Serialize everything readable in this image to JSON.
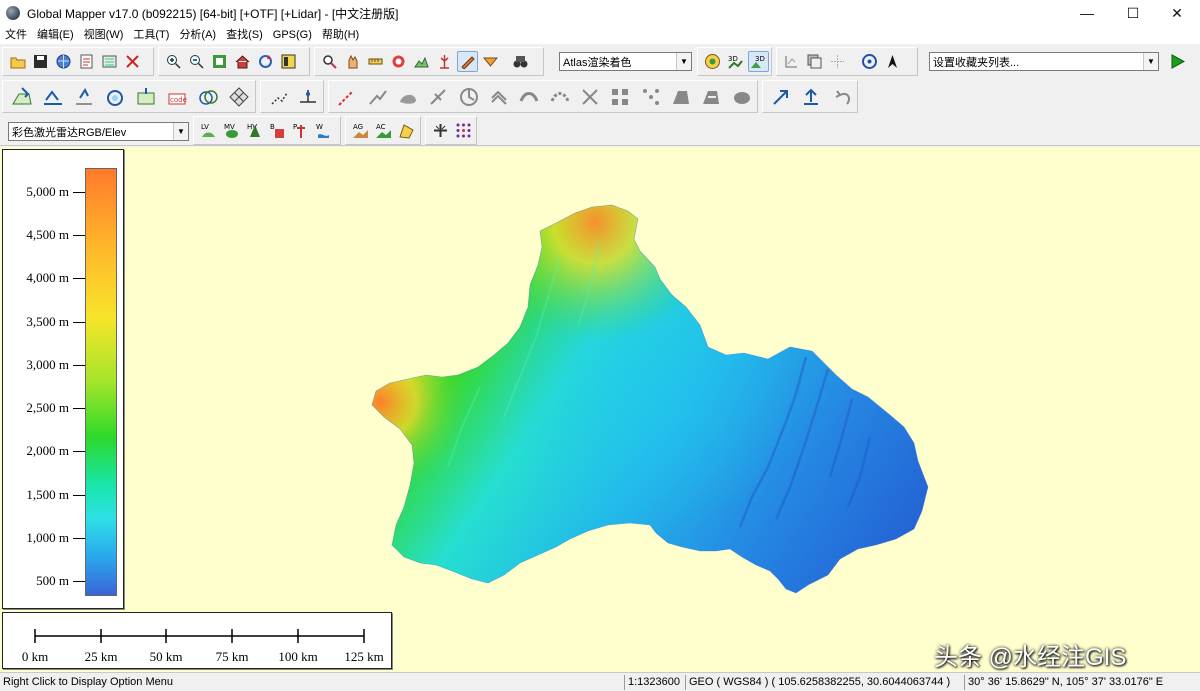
{
  "window": {
    "title": "Global Mapper v17.0 (b092215) [64-bit] [+OTF] [+Lidar] - [中文注册版]",
    "minimize": "—",
    "maximize": "☐",
    "close": "✕"
  },
  "menu": [
    "文件",
    "编辑(E)",
    "视图(W)",
    "工具(T)",
    "分析(A)",
    "查找(S)",
    "GPS(G)",
    "帮助(H)"
  ],
  "toolbar": {
    "shader_combo": "Atlas渲染着色",
    "favorites_combo": "设置收藏夹列表...",
    "lidar_combo": "彩色激光雷达RGB/Elev"
  },
  "legend": {
    "labels": [
      "5,000 m",
      "4,500 m",
      "4,000 m",
      "3,500 m",
      "3,000 m",
      "2,500 m",
      "2,000 m",
      "1,500 m",
      "1,000 m",
      "500 m"
    ],
    "colors": [
      "#ff7a2a",
      "#f7e52a",
      "#2cd92a",
      "#2ee0e6",
      "#3a64d8"
    ]
  },
  "scalebar": {
    "labels": [
      "0 km",
      "25 km",
      "50 km",
      "75 km",
      "100 km",
      "125 km"
    ]
  },
  "watermark": "头条 @水经注GIS",
  "status": {
    "hint": "Right Click to Display Option Menu",
    "scale": "1:1323600",
    "projection": "GEO ( WGS84 ) ( 105.6258382255, 30.6044063744 )",
    "dms": "30° 36' 15.8629\" N, 105° 37' 33.0176\" E"
  }
}
